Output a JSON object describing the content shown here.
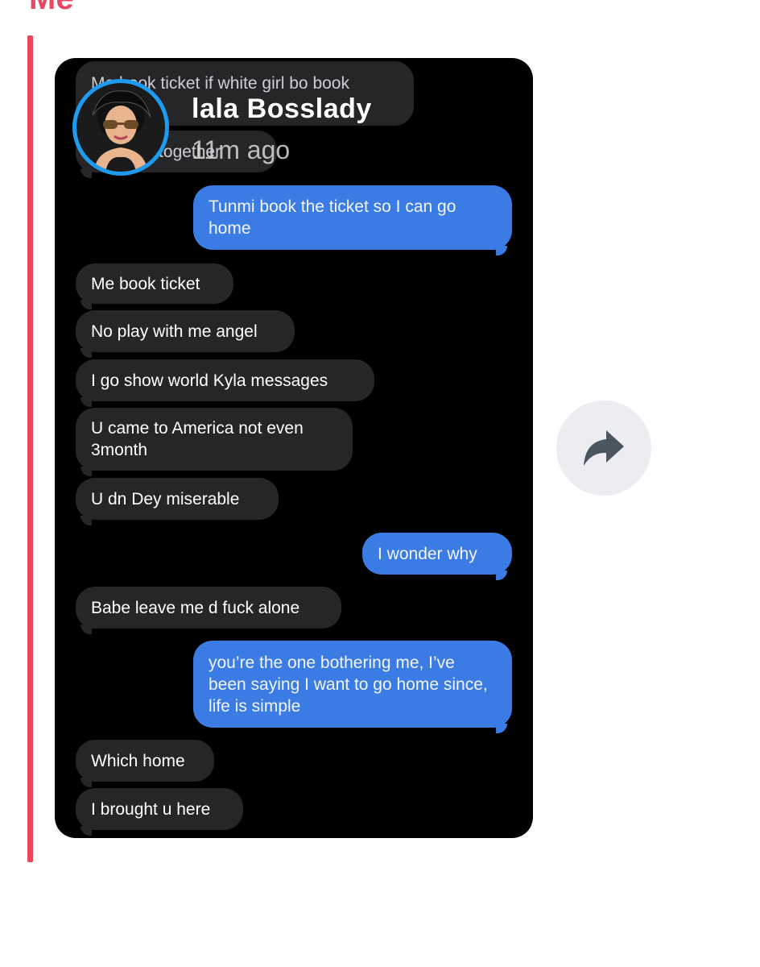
{
  "post": {
    "heading": "Me"
  },
  "screenshot": {
    "header": {
      "username": "lala Bosslady",
      "time_ago": "11m ago"
    },
    "messages": [
      {
        "dir": "in",
        "text": "Me book ticket if white girl bo book"
      },
      {
        "dir": "in",
        "text": "U go die together"
      },
      {
        "dir": "out",
        "text": "Tunmi book the ticket so I can go home"
      },
      {
        "dir": "in",
        "text": "Me book ticket"
      },
      {
        "dir": "in",
        "text": "No play with me angel"
      },
      {
        "dir": "in",
        "text": "I go show world Kyla messages"
      },
      {
        "dir": "in",
        "text": "U came to America not even 3month"
      },
      {
        "dir": "in",
        "text": "U dn Dey miserable"
      },
      {
        "dir": "out",
        "text": "I wonder why"
      },
      {
        "dir": "in",
        "text": "Babe leave me d fuck alone"
      },
      {
        "dir": "out",
        "text": "you’re the one bothering me, I’ve been saying I want to go home since, life is simple"
      },
      {
        "dir": "in",
        "text": "Which home"
      },
      {
        "dir": "in",
        "text": "I brought u here"
      }
    ]
  },
  "actions": {
    "share_icon": "share-arrow-icon"
  },
  "colors": {
    "accent": "#e8475f",
    "outgoing_bubble": "#3b7be4",
    "incoming_bubble": "#262628",
    "avatar_ring": "#1d9bf0",
    "share_button_bg": "#ebedf0"
  }
}
